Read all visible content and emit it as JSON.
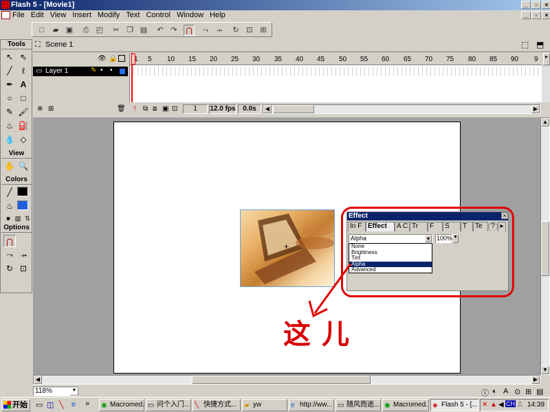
{
  "window": {
    "title": "Flash 5 - [Movie1]"
  },
  "menu": [
    "File",
    "Edit",
    "View",
    "Insert",
    "Modify",
    "Text",
    "Control",
    "Window",
    "Help"
  ],
  "tools_panel": {
    "header": "Tools",
    "sections": [
      "View",
      "Colors",
      "Options"
    ],
    "tools": [
      {
        "icon": "arrow-icon",
        "glyph": "↖"
      },
      {
        "icon": "subselect-icon",
        "glyph": "⇖"
      },
      {
        "icon": "line-icon",
        "glyph": "╱"
      },
      {
        "icon": "lasso-icon",
        "glyph": "ℓ"
      },
      {
        "icon": "pen-icon",
        "glyph": "✒"
      },
      {
        "icon": "text-tool-icon",
        "glyph": "A"
      },
      {
        "icon": "oval-icon",
        "glyph": "○"
      },
      {
        "icon": "rectangle-icon",
        "glyph": "□"
      },
      {
        "icon": "pencil-icon",
        "glyph": "✎"
      },
      {
        "icon": "brush-icon",
        "glyph": "🖌"
      },
      {
        "icon": "ink-bottle-icon",
        "glyph": "♨"
      },
      {
        "icon": "paint-bucket-icon",
        "glyph": "⛽"
      },
      {
        "icon": "dropper-icon",
        "glyph": "💧"
      },
      {
        "icon": "eraser-icon",
        "glyph": "◇"
      }
    ]
  },
  "scene": {
    "label": "Scene 1"
  },
  "timeline": {
    "layer_name": "Layer 1",
    "frame_numbers": [
      "1",
      "5",
      "10",
      "15",
      "20",
      "25",
      "30",
      "35",
      "40",
      "45",
      "50",
      "55",
      "60",
      "65",
      "70",
      "75",
      "80",
      "85",
      "90",
      "9"
    ],
    "current_frame": "1",
    "fps": "12.0 fps",
    "time": "0.0s"
  },
  "effect_panel": {
    "title": "Effect",
    "tabs": [
      "In F",
      "Effect",
      "A C",
      "Tr",
      "F",
      "S",
      "T",
      "Te"
    ],
    "selected": "Alpha",
    "percent": "100%",
    "options": [
      "None",
      "Brightness",
      "Tint",
      "Alpha",
      "Advanced"
    ]
  },
  "annotation": {
    "text": "这儿"
  },
  "zoom": "118%",
  "taskbar": {
    "start": "开始",
    "quick_launch_more": "»",
    "tasks": [
      "Macromed...",
      "问个入门...",
      "快捷方式...",
      "yw",
      "http://ww...",
      "随风而逝...",
      "Macromed...",
      "Flash 5 - [..."
    ],
    "tray_ime": "CH",
    "clock": "14:39"
  },
  "colors": {
    "stroke": "#000000",
    "fill": "#2060e0",
    "annotation": "#e00000",
    "title_bar": "#0a246a"
  }
}
